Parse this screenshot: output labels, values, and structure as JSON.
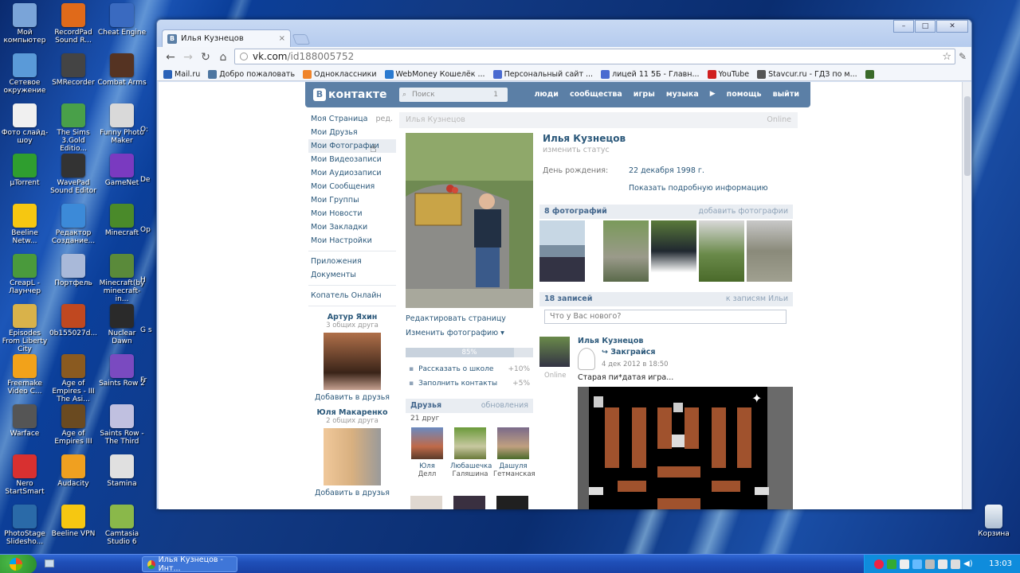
{
  "desktop": {
    "icons": [
      {
        "label": "Мой компьютер",
        "color": "#7aa4d8"
      },
      {
        "label": "Сетевое окружение",
        "color": "#5a9ad8"
      },
      {
        "label": "Фото слайд-шоу",
        "color": "#f0f0f0"
      },
      {
        "label": "µTorrent",
        "color": "#2f9e2f"
      },
      {
        "label": "Beeline Netw...",
        "color": "#f6c711"
      },
      {
        "label": "CreapL - Лаунчер",
        "color": "#4a9a3c"
      },
      {
        "label": "Episodes From Liberty City",
        "color": "#d9b24a"
      },
      {
        "label": "Freemake Video C...",
        "color": "#f2a21a"
      },
      {
        "label": "Warface",
        "color": "#555555"
      },
      {
        "label": "Nero StartSmart",
        "color": "#d83030"
      },
      {
        "label": "PhotoStage Slidesho...",
        "color": "#2a6aa8"
      },
      {
        "label": "RecordPad Sound R...",
        "color": "#e06a1a"
      },
      {
        "label": "SMRecorder",
        "color": "#444444"
      },
      {
        "label": "The Sims 3.Gold Editio...",
        "color": "#49a049"
      },
      {
        "label": "WavePad Sound Editor",
        "color": "#333333"
      },
      {
        "label": "Редактор Создание...",
        "color": "#3c8ad8"
      },
      {
        "label": "Портфель",
        "color": "#a9b9d9"
      },
      {
        "label": "0b155027d...",
        "color": "#c04820"
      },
      {
        "label": "Age of Empires - III The Asi...",
        "color": "#8a5a20"
      },
      {
        "label": "Age of Empires III",
        "color": "#6a4a20"
      },
      {
        "label": "Audacity",
        "color": "#f0a020"
      },
      {
        "label": "Beeline VPN",
        "color": "#f6c711"
      },
      {
        "label": "Cheat Engine",
        "color": "#3a6ac0"
      },
      {
        "label": "Combat Arms",
        "color": "#553322"
      },
      {
        "label": "Funny Photo Maker",
        "color": "#d9d9d9"
      },
      {
        "label": "GameNet",
        "color": "#7a3ac0"
      },
      {
        "label": "Minecraft",
        "color": "#4a8a2a"
      },
      {
        "label": "Minecraft(by minecraft-in...",
        "color": "#5a8a3a"
      },
      {
        "label": "Nuclear Dawn",
        "color": "#2a2a2a"
      },
      {
        "label": "Saints Row 2",
        "color": "#7a4ac0"
      },
      {
        "label": "Saints Row - The Third",
        "color": "#c0c0e0"
      },
      {
        "label": "Stamina",
        "color": "#e0e0e0"
      },
      {
        "label": "Camtasia Studio 6",
        "color": "#8ab84a"
      }
    ],
    "partial": [
      "O:",
      "De",
      "Op",
      "H",
      "G s",
      "Fr"
    ],
    "recycle": "Корзина"
  },
  "browser": {
    "tab_title": "Илья Кузнецов",
    "url_domain": "vk.com",
    "url_path": "/id188005752",
    "bookmarks": [
      {
        "label": "Mail.ru",
        "color": "#2a62b8"
      },
      {
        "label": "Добро пожаловать",
        "color": "#4d76a1"
      },
      {
        "label": "Одноклассники",
        "color": "#f0842a"
      },
      {
        "label": "WebMoney Кошелёк ...",
        "color": "#2a7ad0"
      },
      {
        "label": "Персональный сайт ...",
        "color": "#4a6ad0"
      },
      {
        "label": "лицей 11 5Б - Главн...",
        "color": "#4a6ad0"
      },
      {
        "label": "YouTube",
        "color": "#d02020"
      },
      {
        "label": "Stavcur.ru - ГДЗ по м...",
        "color": "#555555"
      },
      {
        "label": "",
        "color": "#3a6a2a"
      }
    ]
  },
  "vk": {
    "logo": "контакте",
    "search_placeholder": "Поиск",
    "search_count": "1",
    "nav": [
      "люди",
      "сообщества",
      "игры",
      "музыка",
      "помощь",
      "выйти"
    ],
    "menu": [
      "Моя Страница",
      "Мои Друзья",
      "Мои Фотографии",
      "Мои Видеозаписи",
      "Мои Аудиозаписи",
      "Мои Сообщения",
      "Мои Группы",
      "Мои Новости",
      "Мои Закладки",
      "Мои Настройки"
    ],
    "menu_edit": "ред.",
    "menu2": [
      "Приложения",
      "Документы"
    ],
    "menu3": "Копатель Онлайн",
    "suggestions": [
      {
        "name": "Артур Яхин",
        "common": "3 общих друга",
        "add": "Добавить в друзья"
      },
      {
        "name": "Юля Макаренко",
        "common": "2 общих друга",
        "add": "Добавить в друзья"
      }
    ],
    "header_name": "Илья Кузнецов",
    "header_status": "Online",
    "actions": {
      "edit": "Редактировать страницу",
      "change_photo": "Изменить фотографию"
    },
    "progress_label": "85%",
    "progress": 0.85,
    "tips": [
      {
        "label": "Рассказать о школе",
        "plus": "+10%"
      },
      {
        "label": "Заполнить контакты",
        "plus": "+5%"
      }
    ],
    "friends": {
      "title": "Друзья",
      "updates": "обновления",
      "count": "21 друг",
      "list": [
        {
          "first": "Юля",
          "last": "Делл"
        },
        {
          "first": "Любашечка",
          "last": "Галяшина"
        },
        {
          "first": "Дашуля",
          "last": "Гетманская"
        }
      ]
    },
    "profile": {
      "name": "Илья Кузнецов",
      "status": "изменить статус",
      "bday_label": "День рождения:",
      "bday": "22 декабря 1998 г.",
      "more": "Показать подробную информацию"
    },
    "photos": {
      "title": "8 фотографий",
      "add": "добавить фотографии"
    },
    "wall": {
      "title": "18 записей",
      "link": "к записям Ильи",
      "placeholder": "Что у Вас нового?"
    },
    "post": {
      "author": "Илья Кузнецов",
      "game": "Закграйся",
      "date": "4 дек 2012 в 18:50",
      "online": "Online",
      "text": "Старая пи*датая игра..."
    }
  },
  "taskbar": {
    "item": "Илья Кузнецов - Инт...",
    "lang": "RU",
    "clock": "13:03"
  }
}
